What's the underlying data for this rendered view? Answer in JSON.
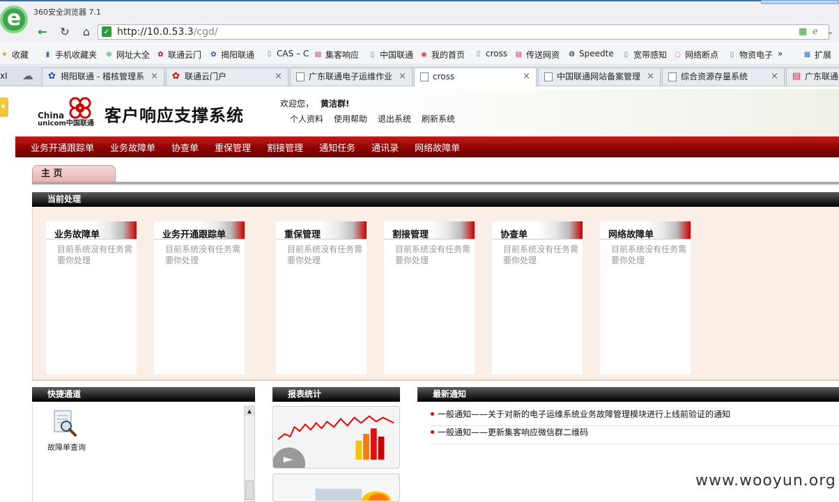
{
  "browser": {
    "app_title": "360安全浏览器 7.1",
    "url_host": "http://10.0.53.3",
    "url_path": "/cgd/",
    "bookmarks": [
      {
        "label": "收藏",
        "icon": "star-icon"
      },
      {
        "label": "手机收藏夹",
        "icon": "phone-icon"
      },
      {
        "label": "网址大全",
        "icon": "globe-icon"
      },
      {
        "label": "联通云门",
        "icon": "unicom-icon"
      },
      {
        "label": "揭阳联通",
        "icon": "unicom-blue-icon"
      },
      {
        "label": "CAS – C",
        "icon": "page-icon"
      },
      {
        "label": "集客响应",
        "icon": "chart-icon"
      },
      {
        "label": "中国联通",
        "icon": "page-icon"
      },
      {
        "label": "我的首页",
        "icon": "weibo-icon"
      },
      {
        "label": "cross",
        "icon": "page-icon"
      },
      {
        "label": "传送网资",
        "icon": "chart-icon"
      },
      {
        "label": "Speedte",
        "icon": "speed-icon"
      },
      {
        "label": "宽带感知",
        "icon": "page-icon"
      },
      {
        "label": "网络断点",
        "icon": "loading-icon"
      },
      {
        "label": "物资电子",
        "icon": "page-icon"
      },
      {
        "label": "扩展",
        "icon": "extension-icon"
      }
    ],
    "tabs": [
      {
        "label": "揭阳联通 - 稽核管理系",
        "icon": "unicom-blue-icon"
      },
      {
        "label": "联通云门户",
        "icon": "unicom-icon"
      },
      {
        "label": "广东联通电子运维作业",
        "icon": "page-icon"
      },
      {
        "label": "cross",
        "icon": "page-icon"
      },
      {
        "label": "中国联通网站备案管理",
        "icon": "page-icon"
      },
      {
        "label": "综合资源存量系统",
        "icon": "page-icon"
      },
      {
        "label": "广东联通",
        "icon": "chart-icon"
      }
    ],
    "tab_stub": "xI"
  },
  "header": {
    "logo_text_1": "China",
    "logo_text_2": "unicom中国联通",
    "system_title": "客户响应支撑系统",
    "welcome_label": "欢迎您，",
    "user_name": "黄洁群!",
    "user_links": [
      "个人资料",
      "使用帮助",
      "退出系统",
      "刷新系统"
    ]
  },
  "menu": [
    "业务开通跟踪单",
    "业务故障单",
    "协查单",
    "重保管理",
    "割接管理",
    "通知任务",
    "通讯录",
    "网络故障单"
  ],
  "home_tab": "主 页",
  "current": {
    "title": "当前处理",
    "cards": [
      {
        "title": "业务故障单",
        "message": "目前系统没有任务需要你处理"
      },
      {
        "title": "业务开通跟踪单",
        "message": "目前系统没有任务需要你处理"
      },
      {
        "title": "重保管理",
        "message": "目前系统没有任务需要你处理"
      },
      {
        "title": "割接管理",
        "message": "目前系统没有任务需要你处理"
      },
      {
        "title": "协查单",
        "message": "目前系统没有任务需要你处理"
      },
      {
        "title": "网络故障单",
        "message": "目前系统没有任务需要你处理"
      }
    ]
  },
  "quick": {
    "title": "快捷通道",
    "items": [
      {
        "label": "故障单查询",
        "icon": "magnifier-document-icon"
      }
    ]
  },
  "report": {
    "title": "报表统计"
  },
  "news": {
    "title": "最新通知",
    "items": [
      "一般通知——关于对新的电子运维系统业务故障管理模块进行上线前验证的通知",
      "一般通知——更新集客响应微信群二维码"
    ]
  },
  "watermark": "www.wooyun.org",
  "colors": {
    "menu_red": "#8b0000",
    "brand_red": "#c00000",
    "section_black": "#000000",
    "card_bg": "#fbeee6"
  }
}
